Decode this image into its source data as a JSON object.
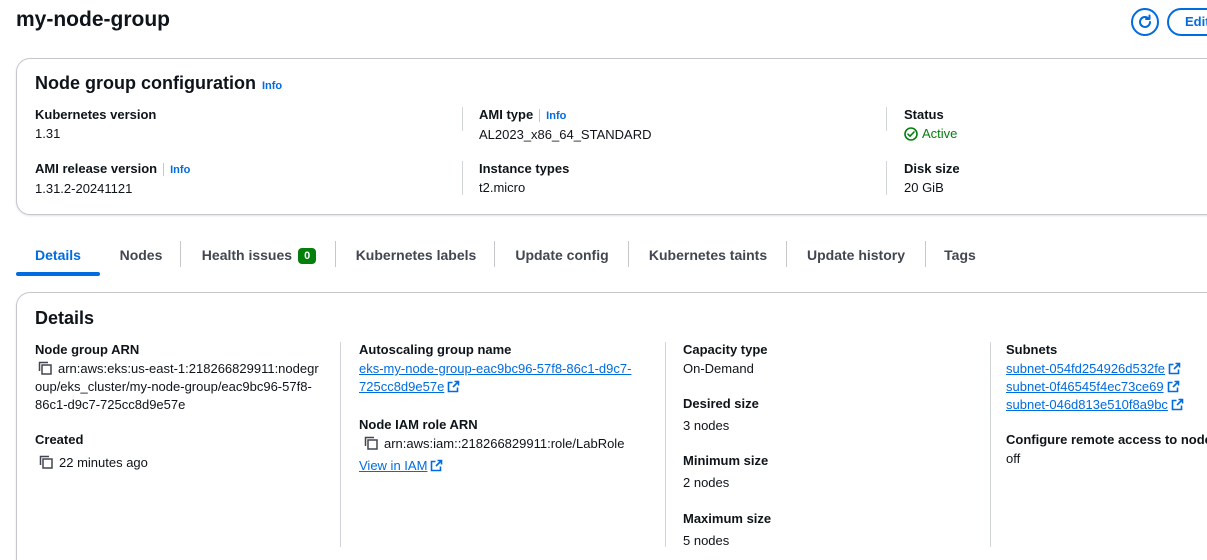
{
  "header": {
    "title": "my-node-group",
    "refresh_icon": "refresh-icon",
    "edit_label": "Edit"
  },
  "config": {
    "title": "Node group configuration",
    "info_label": "Info",
    "kubernetes_version": {
      "label": "Kubernetes version",
      "value": "1.31"
    },
    "ami_release_version": {
      "label": "AMI release version",
      "info_label": "Info",
      "value": "1.31.2-20241121"
    },
    "ami_type": {
      "label": "AMI type",
      "info_label": "Info",
      "value": "AL2023_x86_64_STANDARD"
    },
    "instance_types": {
      "label": "Instance types",
      "value": "t2.micro"
    },
    "status": {
      "label": "Status",
      "value": "Active",
      "color": "#037f0c"
    },
    "disk_size": {
      "label": "Disk size",
      "value": "20 GiB"
    }
  },
  "tabs": [
    {
      "label": "Details",
      "active": true
    },
    {
      "label": "Nodes"
    },
    {
      "label": "Health issues",
      "badge": "0"
    },
    {
      "label": "Kubernetes labels"
    },
    {
      "label": "Update config"
    },
    {
      "label": "Kubernetes taints"
    },
    {
      "label": "Update history"
    },
    {
      "label": "Tags"
    }
  ],
  "details": {
    "title": "Details",
    "node_group_arn": {
      "label": "Node group ARN",
      "line1": "arn:aws:eks:us-east-1:218266829911:nodegr",
      "line2": "oup/eks_cluster/my-node-group/eac9bc96-57f8-",
      "line3": "86c1-d9c7-725cc8d9e57e"
    },
    "created": {
      "label": "Created",
      "value": "22 minutes ago"
    },
    "autoscaling_group": {
      "label": "Autoscaling group name",
      "line1": "eks-my-node-group-eac9bc96-57f8-86c1-d9c7-",
      "line2": "725cc8d9e57e"
    },
    "node_iam_role": {
      "label": "Node IAM role ARN",
      "value": "arn:aws:iam::218266829911:role/LabRole",
      "link_label": "View in IAM"
    },
    "capacity_type": {
      "label": "Capacity type",
      "value": "On-Demand"
    },
    "desired_size": {
      "label": "Desired size",
      "value": "3 nodes"
    },
    "minimum_size": {
      "label": "Minimum size",
      "value": "2 nodes"
    },
    "maximum_size": {
      "label": "Maximum size",
      "value": "5 nodes"
    },
    "subnets": {
      "label": "Subnets",
      "items": [
        "subnet-054fd254926d532fe",
        "subnet-0f46545f4ec73ce69",
        "subnet-046d813e510f8a9bc"
      ]
    },
    "remote_access": {
      "label": "Configure remote access to nodes",
      "value": "off"
    }
  },
  "colors": {
    "accent": "#006ce0",
    "success": "#037f0c",
    "text": "#0f141a"
  }
}
